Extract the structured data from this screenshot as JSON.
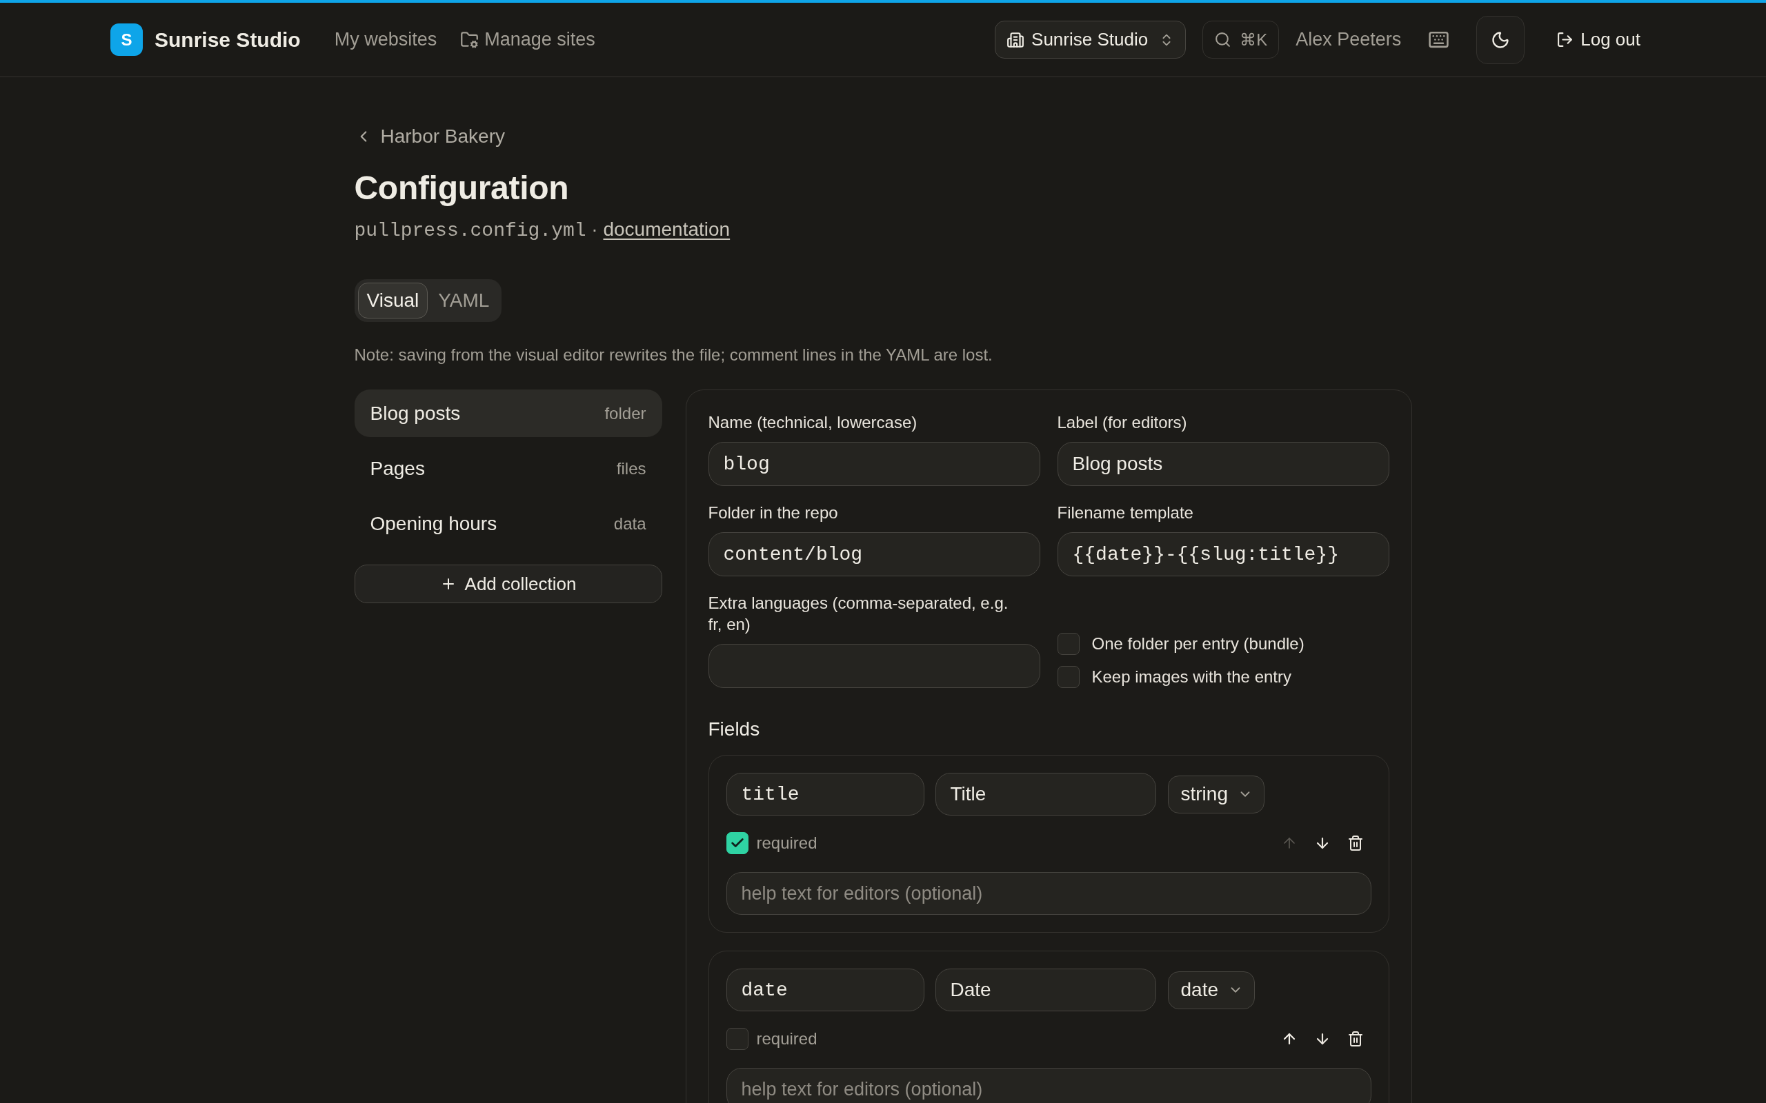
{
  "header": {
    "brand": {
      "initial": "S",
      "name": "Sunrise Studio"
    },
    "nav": [
      {
        "label": "My websites",
        "kind": "plain"
      },
      {
        "label": "Manage sites",
        "kind": "folder"
      }
    ],
    "workspace_switcher": {
      "label": "Sunrise Studio"
    },
    "search": {
      "shortcut": "⌘K"
    },
    "user_name": "Alex Peeters",
    "logout": {
      "label": "Log out"
    }
  },
  "breadcrumb": {
    "back_label": "Harbor Bakery"
  },
  "page_title": "Configuration",
  "subtitle": {
    "file": "pullpress.config.yml",
    "separator": "·",
    "link": "documentation"
  },
  "tabs": [
    {
      "label": "Visual",
      "selected": true
    },
    {
      "label": "YAML",
      "selected": false
    }
  ],
  "note": "Note: saving from the visual editor rewrites the file; comment lines in the YAML are lost.",
  "collections": [
    {
      "name": "Blog posts",
      "type": "folder",
      "selected": true
    },
    {
      "name": "Pages",
      "type": "files",
      "selected": false
    },
    {
      "name": "Opening hours",
      "type": "data",
      "selected": false
    }
  ],
  "add_collection": {
    "label": "Add collection"
  },
  "collection_form": {
    "inputs": [
      {
        "label": "Name (technical, lowercase)",
        "value": "blog",
        "kind": "code"
      },
      {
        "label": "Label (for editors)",
        "value": "Blog posts",
        "kind": "text"
      },
      {
        "label": "Folder in the repo",
        "value": "content/blog",
        "kind": "code"
      },
      {
        "label": "Filename template",
        "value": "{{date}}-{{slug:title}}",
        "kind": "code"
      },
      {
        "label": "Extra languages (comma-separated, e.g. fr, en)",
        "kind": "text"
      }
    ],
    "options": [
      {
        "label": "One folder per entry (bundle)",
        "checked": false
      },
      {
        "label": "Keep images with the entry",
        "checked": false
      }
    ],
    "fields_heading": "Fields",
    "fields": [
      {
        "name": "title",
        "label": "Title",
        "type": "string",
        "required": true,
        "required_label": "required",
        "help_placeholder": "help text for editors (optional)",
        "up_disabled": true
      },
      {
        "name": "date",
        "label": "Date",
        "type": "date",
        "required": false,
        "required_label": "required",
        "help_placeholder": "help text for editors (optional)",
        "up_disabled": false
      }
    ]
  }
}
